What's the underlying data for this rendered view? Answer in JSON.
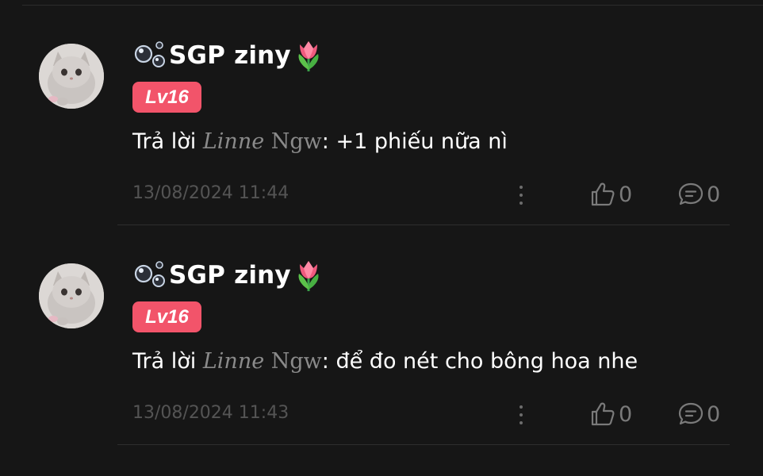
{
  "comments": [
    {
      "username": "SGP ziny",
      "level": "Lv16",
      "reply_prefix": "Trả lời ",
      "mention_first": "Linne",
      "mention_last": " Ngw",
      "reply_body": ": +1 phiếu nữa nì",
      "timestamp": "13/08/2024 11:44",
      "like_count": "0",
      "reply_count": "0"
    },
    {
      "username": "SGP ziny",
      "level": "Lv16",
      "reply_prefix": "Trả lời ",
      "mention_first": "Linne",
      "mention_last": " Ngw",
      "reply_body": ": để đo nét cho bông hoa nhe",
      "timestamp": "13/08/2024 11:43",
      "like_count": "0",
      "reply_count": "0"
    }
  ],
  "icons": {
    "name_prefix": "bubbles-icon",
    "name_suffix": "tulip-icon",
    "like": "thumbs-up-icon",
    "reply": "comment-bubble-icon",
    "more": "vertical-ellipsis-icon"
  },
  "colors": {
    "background": "#161616",
    "level_badge": "#f2546a",
    "muted_text": "#545454",
    "mention_text": "#8a8a8a"
  }
}
